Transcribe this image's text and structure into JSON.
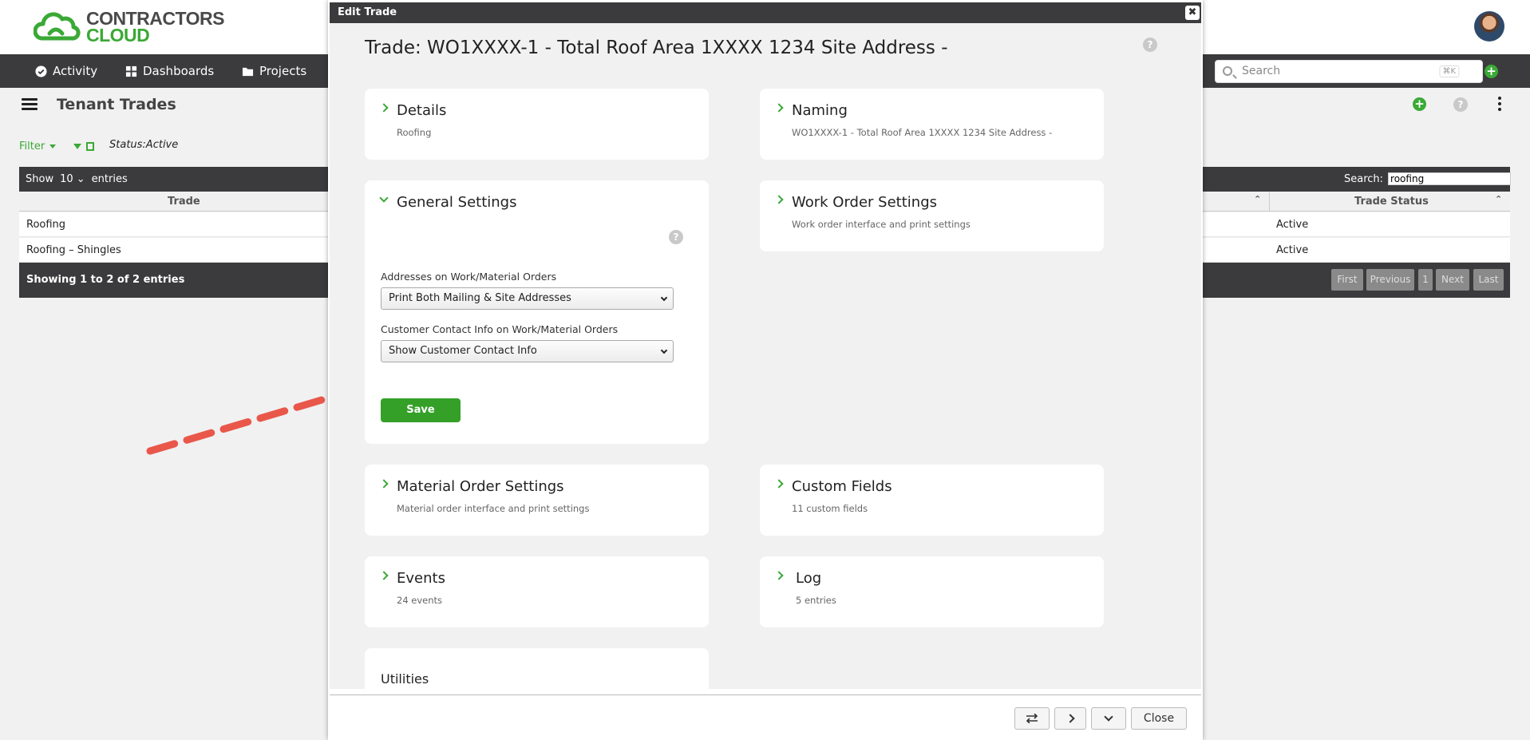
{
  "brand": {
    "line1": "CONTRACTORS",
    "line2": "CLOUD",
    "accent": "#3aa935"
  },
  "nav": {
    "items": [
      {
        "label": "Activity",
        "icon": "check-circle-icon"
      },
      {
        "label": "Dashboards",
        "icon": "grid-icon"
      },
      {
        "label": "Projects",
        "icon": "folder-icon"
      }
    ],
    "search_placeholder": "Search",
    "search_shortcut": "⌘K"
  },
  "page": {
    "title": "Tenant Trades",
    "filter_label": "Filter",
    "status_filter": "Status:Active"
  },
  "table": {
    "show_label": "Show",
    "page_size": "10",
    "entries_label": "entries",
    "search_label": "Search:",
    "search_value": "roofing",
    "columns": [
      "Trade",
      "Trade Status"
    ],
    "rows": [
      {
        "trade": "Roofing",
        "status": "Active"
      },
      {
        "trade": "Roofing – Shingles",
        "status": "Active"
      }
    ],
    "info": "Showing 1 to 2 of 2 entries",
    "pager": [
      "First",
      "Previous",
      "1",
      "Next",
      "Last"
    ]
  },
  "modal": {
    "title": "Edit Trade",
    "heading": "Trade: WO1XXXX-1 - Total Roof Area 1XXXX 1234 Site Address -",
    "cards": {
      "details": {
        "title": "Details",
        "subtitle": "Roofing"
      },
      "naming": {
        "title": "Naming",
        "subtitle": "WO1XXXX-1 - Total Roof Area 1XXXX 1234 Site Address -"
      },
      "general": {
        "title": "General Settings",
        "address_label": "Addresses on Work/Material Orders",
        "address_value": "Print Both Mailing & Site Addresses",
        "contact_label": "Customer Contact Info on Work/Material Orders",
        "contact_value": "Show Customer Contact Info",
        "save_label": "Save"
      },
      "work_order": {
        "title": "Work Order Settings",
        "subtitle": "Work order interface and print settings"
      },
      "material_order": {
        "title": "Material Order Settings",
        "subtitle": "Material order interface and print settings"
      },
      "custom_fields": {
        "title": "Custom Fields",
        "subtitle": "11 custom fields"
      },
      "events": {
        "title": "Events",
        "subtitle": "24 events"
      },
      "log": {
        "title": "Log",
        "subtitle": "5 entries"
      },
      "utilities": {
        "title": "Utilities"
      }
    },
    "footer": {
      "close_label": "Close"
    }
  }
}
